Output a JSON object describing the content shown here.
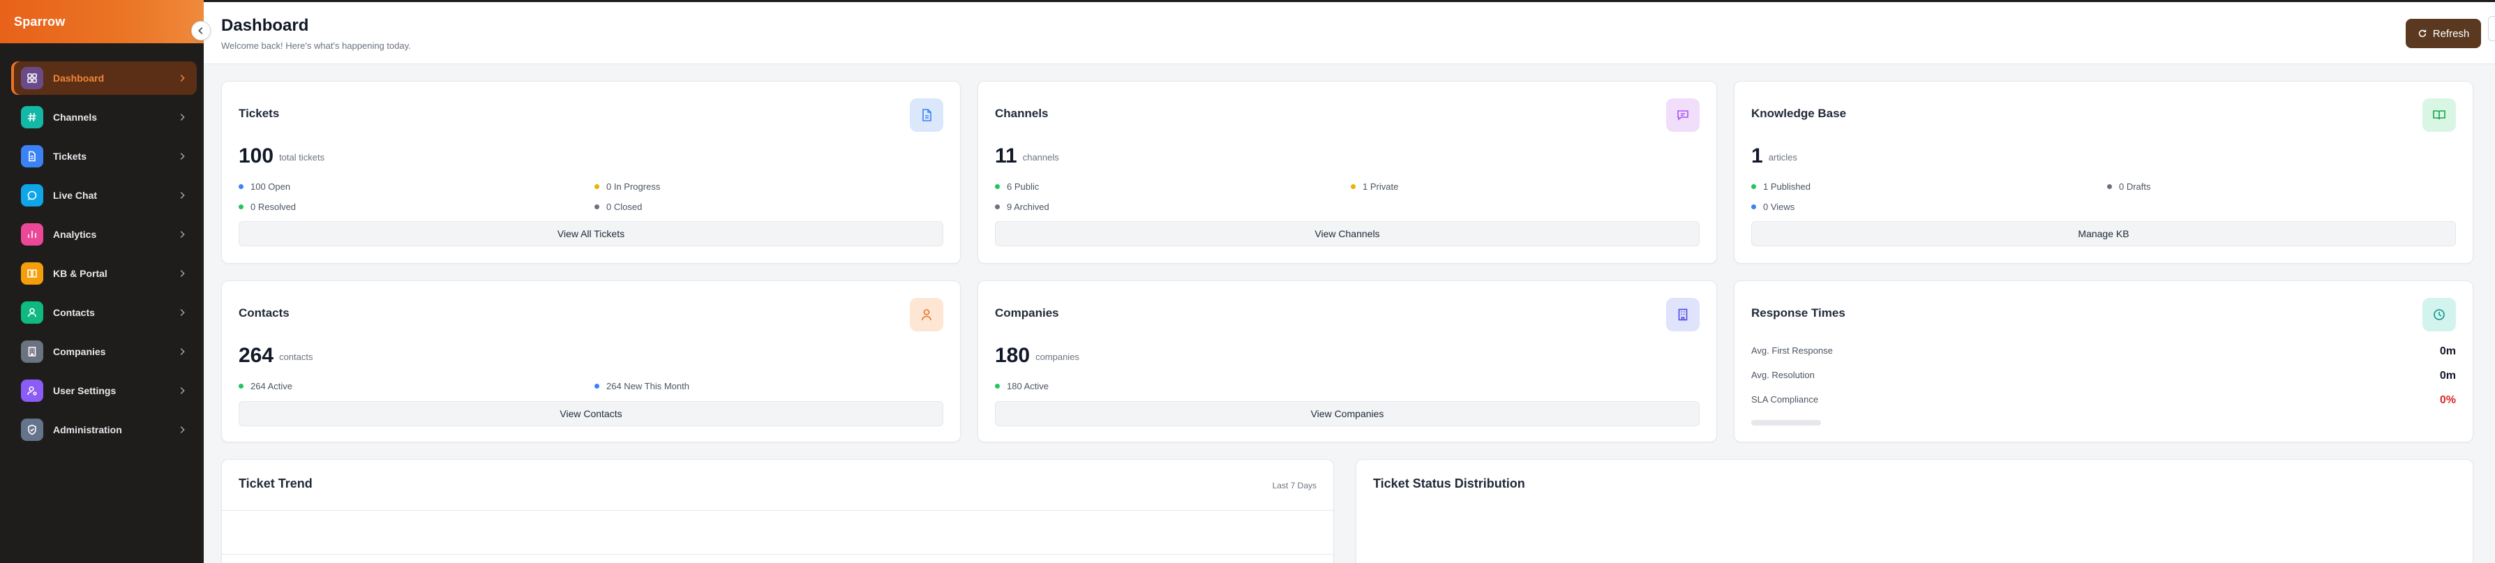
{
  "brand": "Sparrow",
  "sidebar": {
    "items": [
      {
        "label": "Dashboard",
        "icon": "grid-icon",
        "color": "#6b4a8a",
        "active": true
      },
      {
        "label": "Channels",
        "icon": "hash-icon",
        "color": "#14b8a6"
      },
      {
        "label": "Tickets",
        "icon": "document-icon",
        "color": "#3b82f6"
      },
      {
        "label": "Live Chat",
        "icon": "chat-icon",
        "color": "#0ea5e9"
      },
      {
        "label": "Analytics",
        "icon": "chart-icon",
        "color": "#ec4899"
      },
      {
        "label": "KB & Portal",
        "icon": "book-icon",
        "color": "#f59e0b"
      },
      {
        "label": "Contacts",
        "icon": "person-icon",
        "color": "#10b981"
      },
      {
        "label": "Companies",
        "icon": "building-icon",
        "color": "#6b7280"
      },
      {
        "label": "User Settings",
        "icon": "user-cog-icon",
        "color": "#8b5cf6"
      },
      {
        "label": "Administration",
        "icon": "shield-icon",
        "color": "#64748b"
      }
    ]
  },
  "header": {
    "title": "Dashboard",
    "subtitle": "Welcome back! Here's what's happening today.",
    "refresh_label": "Refresh"
  },
  "cards": {
    "tickets": {
      "title": "Tickets",
      "count": "100",
      "unit": "total tickets",
      "stats": [
        "100 Open",
        "0 In Progress",
        "0 Resolved",
        "0 Closed"
      ],
      "button": "View All Tickets"
    },
    "channels": {
      "title": "Channels",
      "count": "11",
      "unit": "channels",
      "stats": [
        "6 Public",
        "1 Private",
        "9 Archived"
      ],
      "button": "View Channels"
    },
    "kb": {
      "title": "Knowledge Base",
      "count": "1",
      "unit": "articles",
      "stats": [
        "1 Published",
        "0 Drafts",
        "0 Views"
      ],
      "button": "Manage KB"
    },
    "contacts": {
      "title": "Contacts",
      "count": "264",
      "unit": "contacts",
      "stats": [
        "264 Active",
        "264 New This Month"
      ],
      "button": "View Contacts"
    },
    "companies": {
      "title": "Companies",
      "count": "180",
      "unit": "companies",
      "stats": [
        "180 Active"
      ],
      "button": "View Companies"
    },
    "response": {
      "title": "Response Times",
      "rows": [
        {
          "label": "Avg. First Response",
          "value": "0m"
        },
        {
          "label": "Avg. Resolution",
          "value": "0m"
        },
        {
          "label": "SLA Compliance",
          "value": "0%"
        }
      ],
      "sla_fraction": 0
    }
  },
  "panels": {
    "trend": {
      "title": "Ticket Trend",
      "meta": "Last 7 Days"
    },
    "status": {
      "title": "Ticket Status Distribution"
    }
  },
  "colors": {
    "accent": "#ea7424",
    "blue": "#3b82f6",
    "yellow": "#eab308",
    "green": "#22c55e",
    "gray": "#6b7280",
    "red": "#dc2626"
  }
}
